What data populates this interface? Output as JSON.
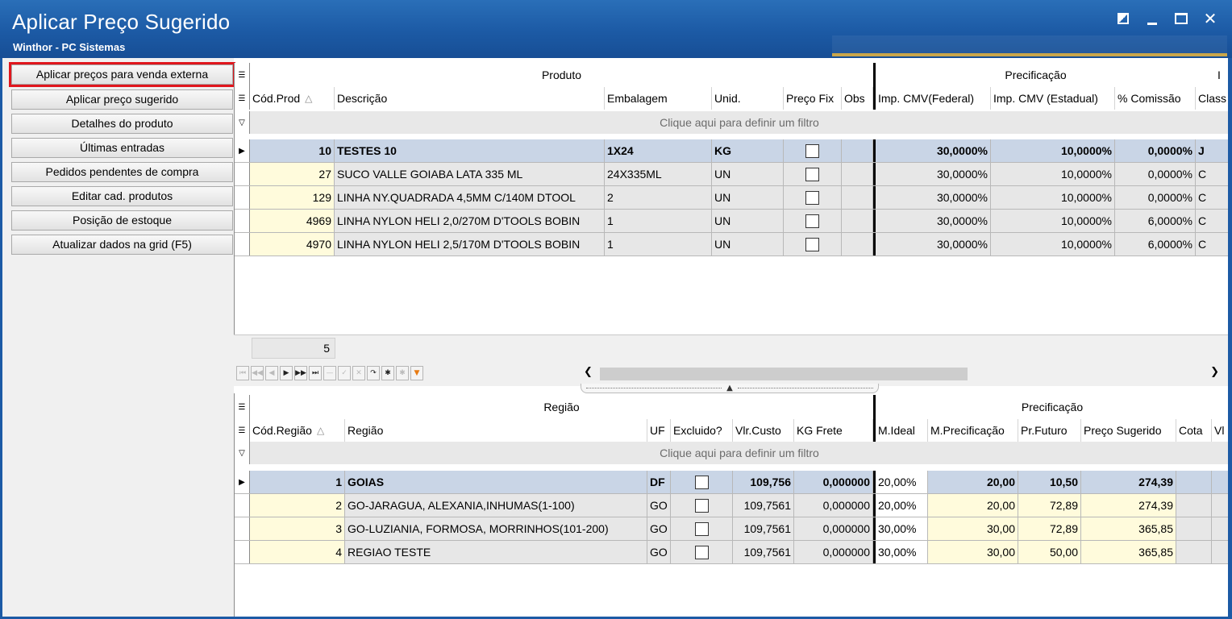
{
  "window": {
    "title": "Aplicar Preço Sugerido",
    "subtitle": "Winthor - PC Sistemas",
    "close_glyph": "✕"
  },
  "actions": [
    {
      "label": "Aplicar preços para venda externa",
      "highlighted": true
    },
    {
      "label": "Aplicar preço sugerido"
    },
    {
      "label": "Detalhes do produto"
    },
    {
      "label": "Últimas entradas"
    },
    {
      "label": "Pedidos pendentes de compra"
    },
    {
      "label": "Editar cad. produtos"
    },
    {
      "label": "Posição de estoque"
    },
    {
      "label": "Atualizar dados na grid (F5)"
    }
  ],
  "produtos": {
    "group_produto": "Produto",
    "group_precificacao": "Precificação",
    "group_extra": "I",
    "columns": [
      "Cód.Prod",
      "Descrição",
      "Embalagem",
      "Unid.",
      "Preço Fix",
      "Obs",
      "Imp. CMV(Federal)",
      "Imp. CMV (Estadual)",
      "% Comissão",
      "Class"
    ],
    "filter_text": "Clique aqui para definir um filtro",
    "rows": [
      {
        "cod": "10",
        "descricao": "TESTES 10",
        "embalagem": "1X24",
        "unid": "KG",
        "federal": "30,0000%",
        "estadual": "10,0000%",
        "comissao": "0,0000%",
        "classe": "J"
      },
      {
        "cod": "27",
        "descricao": "SUCO VALLE GOIABA LATA 335 ML",
        "embalagem": "24X335ML",
        "unid": "UN",
        "federal": "30,0000%",
        "estadual": "10,0000%",
        "comissao": "0,0000%",
        "classe": "C"
      },
      {
        "cod": "129",
        "descricao": "LINHA NY.QUADRADA 4,5MM C/140M DTOOL",
        "embalagem": "2",
        "unid": "UN",
        "federal": "30,0000%",
        "estadual": "10,0000%",
        "comissao": "0,0000%",
        "classe": "C"
      },
      {
        "cod": "4969",
        "descricao": "LINHA NYLON HELI 2,0/270M D'TOOLS BOBIN",
        "embalagem": "1",
        "unid": "UN",
        "federal": "30,0000%",
        "estadual": "10,0000%",
        "comissao": "6,0000%",
        "classe": "C"
      },
      {
        "cod": "4970",
        "descricao": "LINHA NYLON HELI 2,5/170M D'TOOLS BOBIN",
        "embalagem": "1",
        "unid": "UN",
        "federal": "30,0000%",
        "estadual": "10,0000%",
        "comissao": "6,0000%",
        "classe": "C"
      }
    ],
    "record_count": "5"
  },
  "regioes": {
    "group_regiao": "Região",
    "group_precificacao": "Precificação",
    "columns": [
      "Cód.Região",
      "Região",
      "UF",
      "Excluido?",
      "Vlr.Custo",
      "KG Frete",
      "M.Ideal",
      "M.Precificação",
      "Pr.Futuro",
      "Preço Sugerido",
      "Cota",
      "Vl"
    ],
    "filter_text": "Clique aqui para definir um filtro",
    "rows": [
      {
        "cod": "1",
        "regiao": "GOIAS",
        "uf": "DF",
        "custo": "109,756",
        "frete": "0,000000",
        "ideal": "20,00%",
        "mprec": "20,00",
        "futuro": "10,50",
        "sugerido": "274,39"
      },
      {
        "cod": "2",
        "regiao": "GO-JARAGUA, ALEXANIA,INHUMAS(1-100)",
        "uf": "GO",
        "custo": "109,7561",
        "frete": "0,000000",
        "ideal": "20,00%",
        "mprec": "20,00",
        "futuro": "72,89",
        "sugerido": "274,39"
      },
      {
        "cod": "3",
        "regiao": "GO-LUZIANIA, FORMOSA, MORRINHOS(101-200)",
        "uf": "GO",
        "custo": "109,7561",
        "frete": "0,000000",
        "ideal": "30,00%",
        "mprec": "30,00",
        "futuro": "72,89",
        "sugerido": "365,85"
      },
      {
        "cod": "4",
        "regiao": "REGIAO TESTE",
        "uf": "GO",
        "custo": "109,7561",
        "frete": "0,000000",
        "ideal": "30,00%",
        "mprec": "30,00",
        "futuro": "50,00",
        "sugerido": "365,85"
      }
    ]
  },
  "colors": {
    "titlebar": "#1c5aa5",
    "highlight": "#e0161d",
    "selected_row": "#c9d5e6",
    "editable_cell": "#fffbdc"
  }
}
